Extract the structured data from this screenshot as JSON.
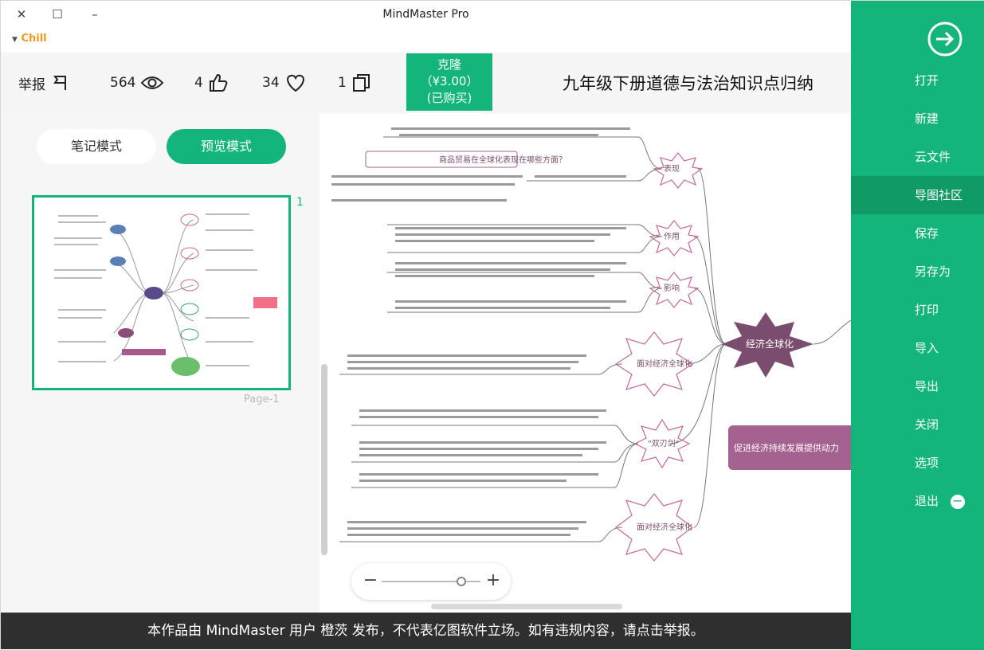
{
  "window": {
    "title": "MindMaster Pro",
    "account": "Chill"
  },
  "header": {
    "doc_title": "九年级下册道德与法治知识点归纳",
    "buy": {
      "line1": "克隆",
      "line2": "（¥3.00）",
      "line3": "(已购买)"
    },
    "stats": {
      "copies": "1",
      "likes": "34",
      "thumbs": "4",
      "views": "564",
      "report": "举报"
    }
  },
  "left_panel": {
    "preview_mode_label": "预览模式",
    "note_mode_label": "笔记模式",
    "page_number": "1",
    "page_label": "Page-1"
  },
  "mindmap": {
    "central": "经济全球化",
    "right_node": "促进经济持续发展提供动力",
    "branches": [
      {
        "label": "表现",
        "items": [
          "商品贸易在全球范围内进",
          "商品贸易在全球化表现在哪些方面？"
        ]
      },
      {
        "label": "作用",
        "items": [
          "商品贸易在全球范围内进行，一方面，生产者可以根据各地的优势，另一方面，消费者可以更方便地买到世界各地的商品。"
        ]
      },
      {
        "label": "影响",
        "items": [
          "积极影响",
          "消极影响"
        ]
      },
      {
        "label": "面对经济全球化",
        "items": [
          "面对经济全球化，我们要积极应对，在竞争与合作中发展自己。"
        ]
      },
      {
        "label": "\"双刃剑\"",
        "items": [
          "(1)经济全球化，(2)经济全球化，(3)经济全球化"
        ]
      },
      {
        "label": "面对经济全球化",
        "items": [
          "面对经济全球化，我们要做好准备。"
        ]
      }
    ]
  },
  "zoom": {
    "minus": "−",
    "plus": "+"
  },
  "footer": {
    "notice": "本作品由 MindMaster 用户 橙茨 发布，不代表亿图软件立场。如有违规内容，请点击举报。"
  },
  "sidebar": {
    "items": [
      {
        "label": "打开"
      },
      {
        "label": "新建"
      },
      {
        "label": "云文件"
      },
      {
        "label": "导图社区",
        "active": true
      },
      {
        "label": "保存"
      },
      {
        "label": "另存为"
      },
      {
        "label": "打印"
      },
      {
        "label": "导入"
      },
      {
        "label": "导出"
      },
      {
        "label": "关闭"
      },
      {
        "label": "选项"
      },
      {
        "label": "退出"
      }
    ]
  },
  "colors": {
    "accent": "#14b57a",
    "sidebar_active": "#0f9a66",
    "footer_bg": "#2f2f2f",
    "node_purple": "#8b4e7a"
  }
}
